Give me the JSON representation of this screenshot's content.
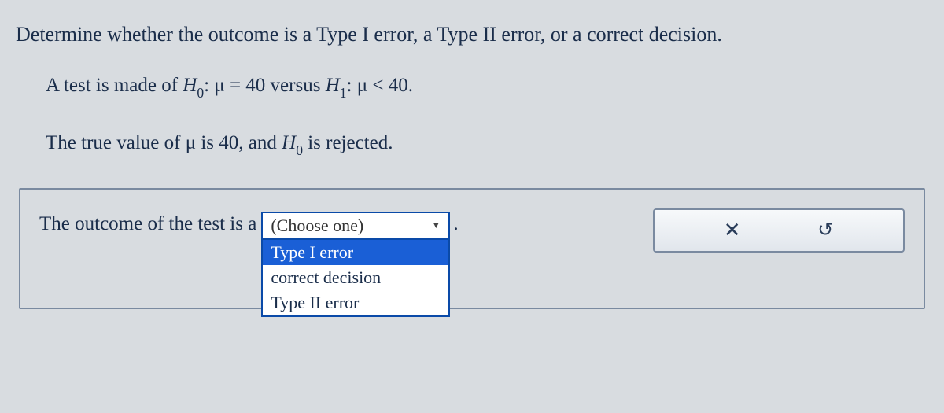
{
  "question": {
    "prompt": "Determine whether the outcome is a Type I error, a Type II error, or a correct decision.",
    "line1_pre": "A test is made of ",
    "H0": "H",
    "H0_sub": "0",
    "line1_h0_expr": ": μ = 40",
    "line1_vs": " versus ",
    "H1": "H",
    "H1_sub": "1",
    "line1_h1_expr": ": μ < 40.",
    "line2_pre": "The true value of μ is 40, and ",
    "line2_H0": "H",
    "line2_H0_sub": "0",
    "line2_post": " is rejected."
  },
  "answer": {
    "lead": "The outcome of the test is a ",
    "placeholder": "(Choose one)",
    "period": ".",
    "options": [
      "Type I error",
      "correct decision",
      "Type II error"
    ],
    "highlighted_index": 0
  },
  "actions": {
    "clear_glyph": "✕",
    "undo_glyph": "↺"
  }
}
